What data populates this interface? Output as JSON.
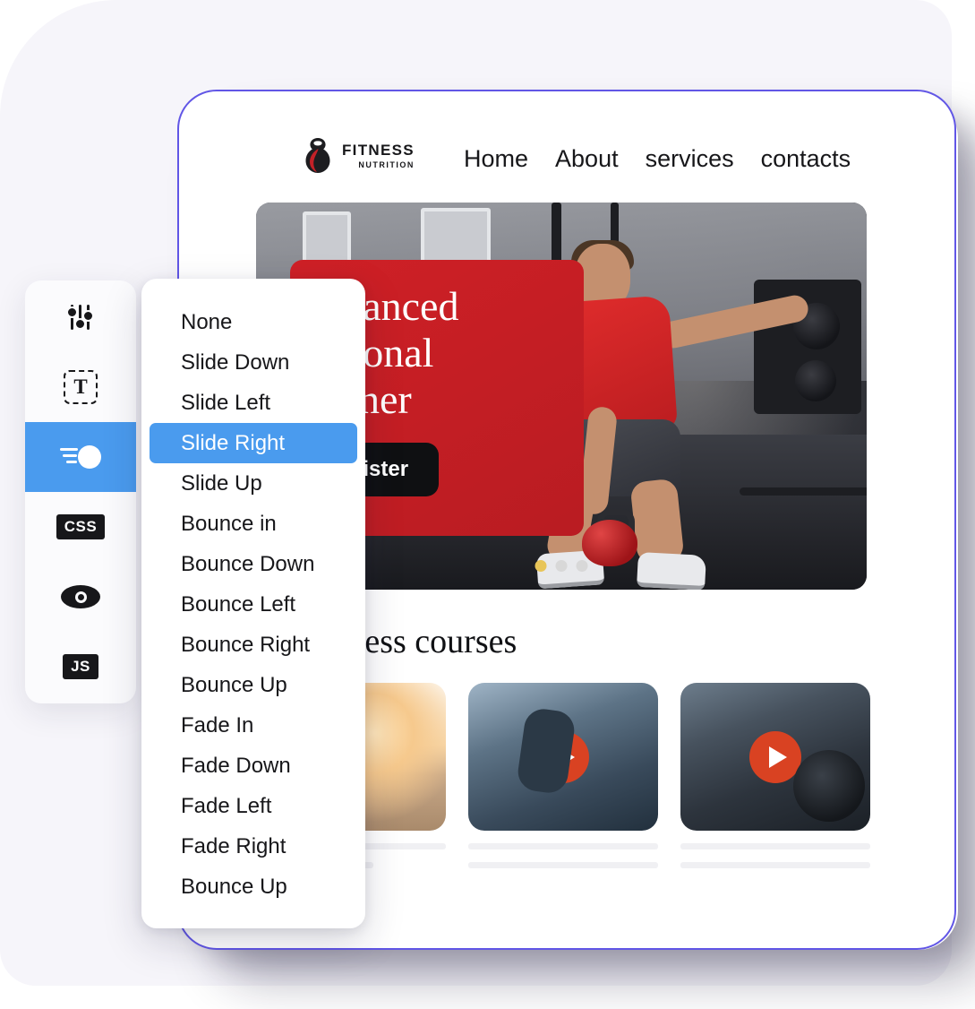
{
  "theme": {
    "frame_border": "#6156e6",
    "accent_blue": "#4a9bee",
    "brand_red": "#cf2026",
    "play_orange": "#d94222",
    "dot_active": "#e8c558",
    "page_bg": "#f6f5fa"
  },
  "toolbar": {
    "items": [
      {
        "icon": "sliders-icon",
        "name": "settings",
        "selected": false
      },
      {
        "icon": "textbox-icon",
        "name": "text",
        "selected": false
      },
      {
        "icon": "motion-icon",
        "name": "animation",
        "selected": true
      },
      {
        "icon": "css-badge-icon",
        "name": "css",
        "label": "CSS",
        "selected": false
      },
      {
        "icon": "eye-icon",
        "name": "preview",
        "selected": false
      },
      {
        "icon": "js-badge-icon",
        "name": "js",
        "label": "JS",
        "selected": false
      }
    ]
  },
  "dropdown": {
    "selected": "Slide Right",
    "options": [
      "None",
      "Slide Down",
      "Slide Left",
      "Slide Right",
      "Slide Up",
      "Bounce in",
      "Bounce Down",
      "Bounce Left",
      "Bounce Right",
      "Bounce Up",
      "Fade In",
      "Fade Down",
      "Fade Left",
      "Fade Right",
      "Bounce Up"
    ]
  },
  "site": {
    "brand": {
      "name": "FITNESS",
      "sub": "NUTRITION",
      "logo_icon": "kettlebell-logo-icon"
    },
    "nav": [
      {
        "label": "Home"
      },
      {
        "label": "About"
      },
      {
        "label": "services"
      },
      {
        "label": "contacts"
      }
    ],
    "hero": {
      "title": "Advanced\nPersonal\nTrainer",
      "button": "Register",
      "dots": 3,
      "active_dot": 0
    },
    "courses": {
      "heading": "Our fitness courses",
      "cards": [
        {
          "thumb": "yoga-sunset-thumb",
          "has_play": false
        },
        {
          "thumb": "treadmill-gym-thumb",
          "has_play": true
        },
        {
          "thumb": "barbell-coach-thumb",
          "has_play": true
        }
      ]
    }
  }
}
